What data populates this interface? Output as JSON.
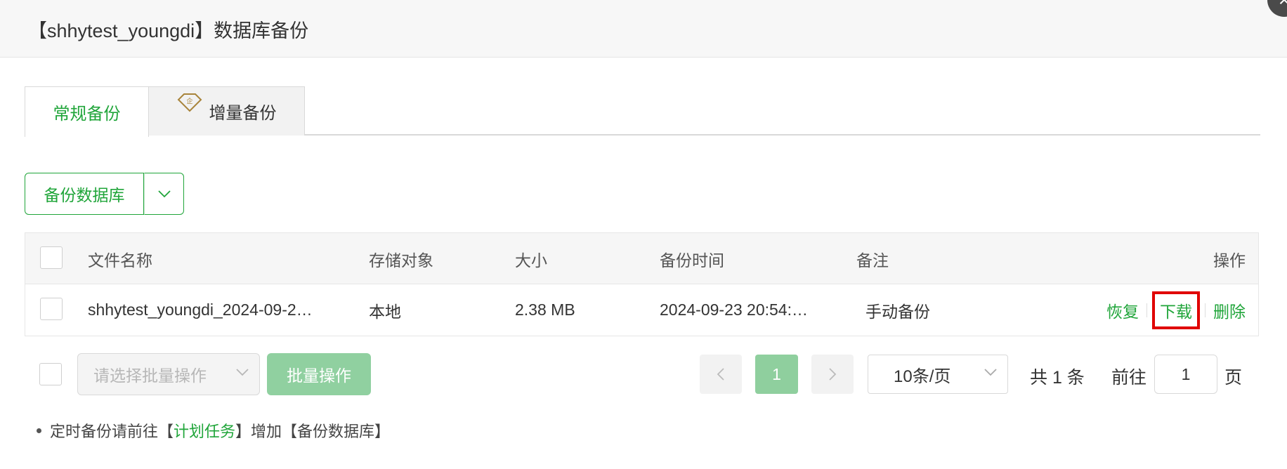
{
  "dialog": {
    "title": "【shhytest_youngdi】数据库备份",
    "close_label": "×"
  },
  "tabs": [
    {
      "label": "常规备份",
      "active": true
    },
    {
      "label": "增量备份",
      "active": false,
      "badge_icon": "enterprise-gem-icon",
      "badge_text": "企"
    }
  ],
  "toolbar": {
    "backup_label": "备份数据库",
    "dropdown_icon": "chevron-down-icon"
  },
  "table": {
    "headers": {
      "name": "文件名称",
      "storage": "存储对象",
      "size": "大小",
      "time": "备份时间",
      "note": "备注",
      "ops": "操作"
    },
    "rows": [
      {
        "name": "shhytest_youngdi_2024-09-2…",
        "storage": "本地",
        "size": "2.38 MB",
        "time": "2024-09-23 20:54:…",
        "note": "手动备份",
        "ops": {
          "restore": "恢复",
          "download": "下载",
          "delete": "删除"
        }
      }
    ]
  },
  "footer": {
    "batch_placeholder": "请选择批量操作",
    "batch_button": "批量操作",
    "current_page": "1",
    "page_size": "10条/页",
    "total": "共 1 条",
    "goto_label": "前往",
    "goto_value": "1",
    "page_unit": "页"
  },
  "tip": {
    "prefix": "定时备份请前往【",
    "link": "计划任务",
    "suffix": "】增加【备份数据库】"
  },
  "colors": {
    "accent": "#20a53a",
    "highlight": "#e00000"
  }
}
